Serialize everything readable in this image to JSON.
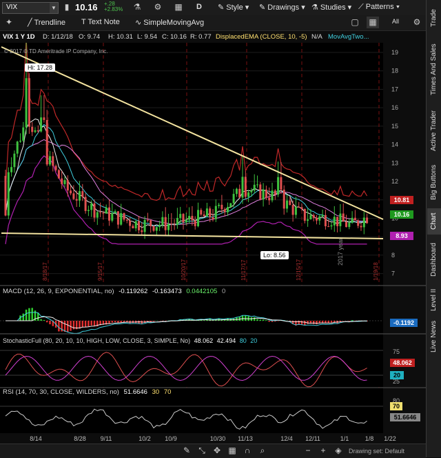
{
  "toolbar": {
    "symbol": "VIX",
    "price": "10.16",
    "change": "+.28",
    "change_pct": "+2.83%",
    "style_label": "Style",
    "drawings_label": "Drawings",
    "studies_label": "Studies",
    "patterns_label": "Patterns",
    "period_label": "D"
  },
  "drawing_toolbar": {
    "trendline_label": "Trendline",
    "textnote_label": "Text Note",
    "sma_label": "SimpleMovingAvg",
    "all_label": "All"
  },
  "header": {
    "title": "VIX 1 Y 1D",
    "date": "D: 1/12/18",
    "open": "O: 9.74",
    "high": "H: 10.31",
    "low": "L: 9.54",
    "close": "C: 10.16",
    "range": "R: 0.77",
    "study1": "DisplacedEMA (CLOSE, 10, -5)",
    "study1_val": "N/A",
    "study2": "MovAvgTwo...",
    "copyright": "© 2017 © TD Ameritrade IP Company, Inc."
  },
  "annotations": {
    "hi_label": "Hi: 17.28",
    "lo_label": "Lo: 8.56",
    "year_label": "2017 year"
  },
  "price_axis": {
    "ticks": [
      "19",
      "18",
      "17",
      "16",
      "15",
      "14",
      "13",
      "12",
      "11",
      "10",
      "9",
      "8",
      "7"
    ],
    "tag_upper": "10.81",
    "tag_last": "10.16",
    "tag_lower": "8.93",
    "tag_upper_color": "#c02020",
    "tag_last_color": "#1f9a1f",
    "tag_lower_color": "#b020b0"
  },
  "event_dates": [
    "8/18/17",
    "9/15/17",
    "10/20/17",
    "11/17/17",
    "12/15/17",
    "1/19/18"
  ],
  "date_axis": [
    "8/14",
    "8/28",
    "9/11",
    "10/2",
    "10/9",
    "10/30",
    "11/13",
    "12/4",
    "12/11",
    "1/1",
    "1/8",
    "1/22"
  ],
  "macd": {
    "label": "MACD (12, 26, 9, EXPONENTIAL, no)",
    "v1": "-0.119262",
    "v2": "-0.163473",
    "v3": "0.0442105",
    "v4": "0",
    "tag": "-0.1192"
  },
  "stoch": {
    "label": "StochasticFull (80, 20, 10, 10, HIGH, LOW, CLOSE, 3, SIMPLE, No)",
    "v1": "48.062",
    "v2": "42.494",
    "v3": "80",
    "v4": "20",
    "tick_75": "75",
    "tick_50": "50",
    "tick_25": "25",
    "tag_value": "48.062",
    "tag_20": "20"
  },
  "rsi": {
    "label": "RSI (14, 70, 30, CLOSE, WILDERS, no)",
    "v1": "51.6646",
    "v2": "30",
    "v3": "70",
    "tick_top": "80",
    "tag_70": "70",
    "tag_value": "51.6646"
  },
  "sidebar_tabs": [
    "Trade",
    "Times And Sales",
    "Active Trader",
    "Big Buttons",
    "Chart",
    "Dashboard",
    "Level II",
    "Live News"
  ],
  "bottom": {
    "drawing_set": "Drawing set: Default"
  },
  "chart_data": {
    "type": "candlestick",
    "title": "VIX 1 Y 1D",
    "ylim": [
      6.8,
      19.3
    ],
    "x": [
      "8/14",
      "8/28",
      "9/11",
      "10/2",
      "10/9",
      "10/30",
      "11/13",
      "12/4",
      "12/11",
      "1/1",
      "1/8"
    ],
    "close_approx": [
      13.5,
      11.0,
      10.6,
      9.7,
      9.8,
      10.2,
      11.4,
      10.9,
      10.2,
      9.8,
      10.16
    ],
    "high_marker": 17.28,
    "low_marker": 8.56,
    "last": 10.16,
    "bollinger_upper": 10.81,
    "bollinger_lower": 8.93
  }
}
